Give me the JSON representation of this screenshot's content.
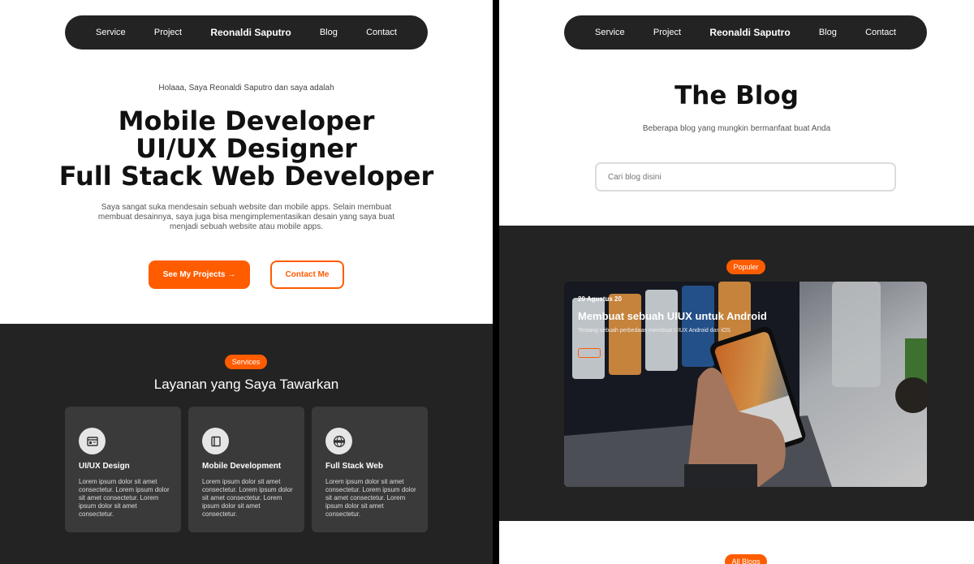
{
  "left": {
    "nav": {
      "service": "Service",
      "project": "Project",
      "brand": "Reonaldi Saputro",
      "blog": "Blog",
      "contact": "Contact"
    },
    "hero": {
      "intro": "Holaaa, Saya  Reonaldi Saputro dan saya adalah",
      "title_lines": [
        "Mobile Developer",
        "UI/UX Designer",
        "Full Stack Web Developer"
      ],
      "description": "Saya sangat suka mendesain sebuah website dan mobile apps. Selain membuat membuat desainnya, saya juga bisa mengimplementasikan desain yang saya buat menjadi sebuah website atau mobile apps.",
      "primary_button": "See My Projects →",
      "secondary_button": "Contact Me"
    },
    "services": {
      "pill": "Services",
      "heading": "Layanan yang Saya Tawarkan",
      "cards": [
        {
          "title": "UI/UX Design",
          "icon": "layout-icon",
          "desc": "Lorem ipsum dolor sit amet consectetur. Lorem ipsum dolor sit amet consectetur. Lorem ipsum dolor sit amet consectetur."
        },
        {
          "title": "Mobile Development",
          "icon": "mobile-icon",
          "desc": "Lorem ipsum dolor sit amet consectetur. Lorem ipsum dolor sit amet consectetur. Lorem ipsum dolor sit amet consectetur."
        },
        {
          "title": "Full Stack Web",
          "icon": "www-icon",
          "desc": "Lorem ipsum dolor sit amet consectetur. Lorem ipsum dolor sit amet consectetur. Lorem ipsum dolor sit amet consectetur."
        }
      ]
    }
  },
  "right": {
    "nav": {
      "service": "Service",
      "project": "Project",
      "brand": "Reonaldi Saputro",
      "blog": "Blog",
      "contact": "Contact"
    },
    "title": "The Blog",
    "subtitle": "Beberapa blog yang mungkin bermanfaat buat Anda",
    "search_placeholder": "Cari blog disini",
    "popular": {
      "pill": "Populer",
      "date": "20 Agustus 20",
      "title": "Membuat sebuah UIUX untuk Android",
      "desc": "Tentang sebuah perbedaan membuat UIUX Android dan iOS"
    },
    "all_pill": "All Blogs"
  },
  "colors": {
    "accent": "#ff5c00",
    "dark": "#232323",
    "card": "#3a3a3a"
  }
}
